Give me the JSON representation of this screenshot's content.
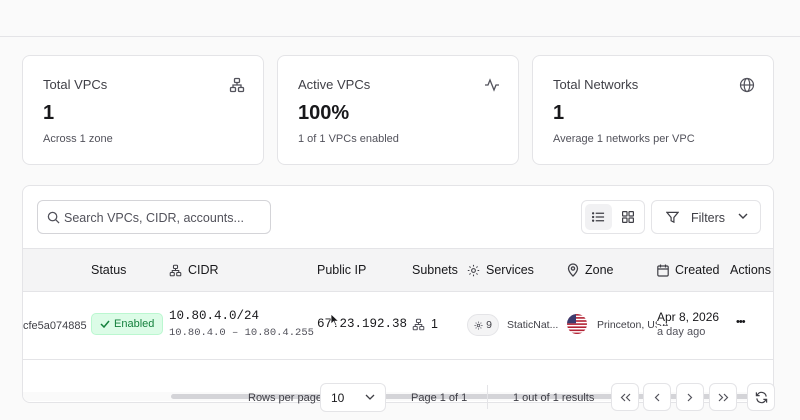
{
  "stats": [
    {
      "title": "Total VPCs",
      "value": "1",
      "subtitle": "Across 1 zone",
      "icon": "network-icon"
    },
    {
      "title": "Active VPCs",
      "value": "100%",
      "subtitle": "1 of 1 VPCs enabled",
      "icon": "activity-icon"
    },
    {
      "title": "Total Networks",
      "value": "1",
      "subtitle": "Average 1 networks per VPC",
      "icon": "globe-icon"
    }
  ],
  "toolbar": {
    "search_placeholder": "Search VPCs, CIDR, accounts...",
    "filters_label": "Filters",
    "view_mode": "list"
  },
  "table": {
    "columns": {
      "status": "Status",
      "cidr": "CIDR",
      "public_ip": "Public IP",
      "subnets": "Subnets",
      "services": "Services",
      "zone": "Zone",
      "created": "Created",
      "actions": "Actions"
    },
    "rows": [
      {
        "id_fragment": "cfe5a074885",
        "status": "Enabled",
        "cidr": "10.80.4.0/24",
        "cidr_range": "10.80.4.0 – 10.80.4.255",
        "public_ip": "67.23.192.38",
        "subnets": "1",
        "services_count": "9",
        "services_name": "StaticNat...",
        "zone": "Princeton, USA",
        "created_date": "Apr 8, 2026",
        "created_relative": "a day ago",
        "actions": "•••"
      }
    ]
  },
  "pagination": {
    "rows_per_page_label": "Rows per page",
    "rows_per_page_value": "10",
    "page_info": "Page 1 of 1",
    "results_info": "1 out of 1 results"
  },
  "colors": {
    "accent_green": "#15803d",
    "badge_bg": "#dcfce7",
    "border": "#e4e4e7"
  }
}
